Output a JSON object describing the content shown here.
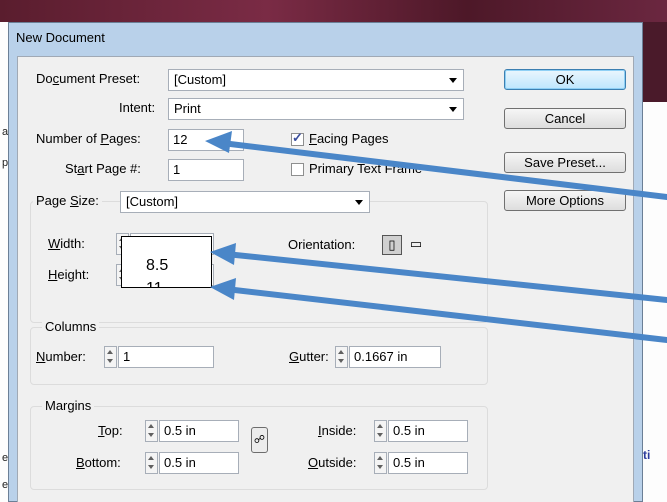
{
  "background": {
    "left_fragments": [
      "a",
      "p",
      "e",
      "e"
    ],
    "right_fragments": [
      "ti"
    ]
  },
  "dialog": {
    "title": "New Document",
    "document_preset": {
      "label_pre": "Do",
      "label_u": "c",
      "label_post": "ument Preset:",
      "value": "[Custom]"
    },
    "intent": {
      "label": "Intent:",
      "value": "Print"
    },
    "number_of_pages": {
      "label_pre": "Number of ",
      "label_u": "P",
      "label_post": "ages:",
      "value": "12"
    },
    "start_page": {
      "label_pre": "St",
      "label_u": "a",
      "label_post": "rt Page #:",
      "value": "1"
    },
    "facing_pages": {
      "label_pre": "",
      "label_u": "F",
      "label_post": "acing Pages",
      "checked": true
    },
    "primary_text_frame": {
      "label": "Primary Text Frame",
      "checked": false
    },
    "page_size": {
      "label_pre": "Page ",
      "label_u": "S",
      "label_post": "ize:",
      "value": "[Custom]",
      "width": {
        "label_u": "W",
        "label_post": "idth:"
      },
      "height": {
        "label_u": "H",
        "label_post": "eight:"
      },
      "orientation_label": "Orientation:"
    },
    "columns": {
      "title": "Columns",
      "number": {
        "label_u": "N",
        "label_post": "umber:",
        "value": "1"
      },
      "gutter": {
        "label_u": "G",
        "label_post": "utter:",
        "value": "0.1667 in"
      }
    },
    "margins": {
      "title": "Margins",
      "top": {
        "label_u": "T",
        "label_post": "op:",
        "value": "0.5 in"
      },
      "bottom": {
        "label_u": "B",
        "label_post": "ottom:",
        "value": "0.5 in"
      },
      "inside": {
        "label_u": "I",
        "label_post": "nside:",
        "value": "0.5 in"
      },
      "outside": {
        "label_u": "O",
        "label_post": "utside:",
        "value": "0.5 in"
      }
    },
    "buttons": {
      "ok": "OK",
      "cancel": "Cancel",
      "save_preset": "Save Preset...",
      "more_options": "More Options"
    }
  },
  "annotation": {
    "callout_width": "8.5",
    "callout_height": "11",
    "arrow_color": "#4a86c8"
  }
}
